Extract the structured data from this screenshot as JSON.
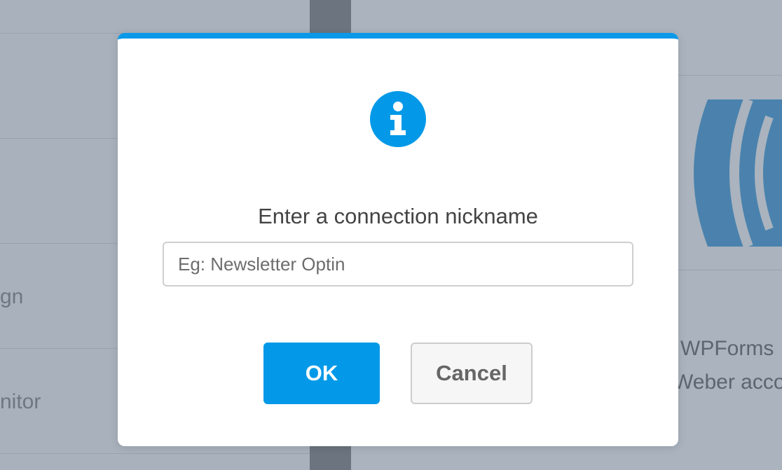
{
  "background": {
    "left_rows": [
      "gn",
      "nitor"
    ],
    "right_lines": [
      "WPForms",
      "Weber acco"
    ]
  },
  "dialog": {
    "icon": "info-icon",
    "title": "Enter a connection nickname",
    "input": {
      "value": "",
      "placeholder": "Eg: Newsletter Optin"
    },
    "ok_label": "OK",
    "cancel_label": "Cancel"
  },
  "colors": {
    "accent": "#0399e8",
    "overlay": "#a9b2bd",
    "logo": "#4a82ad"
  }
}
